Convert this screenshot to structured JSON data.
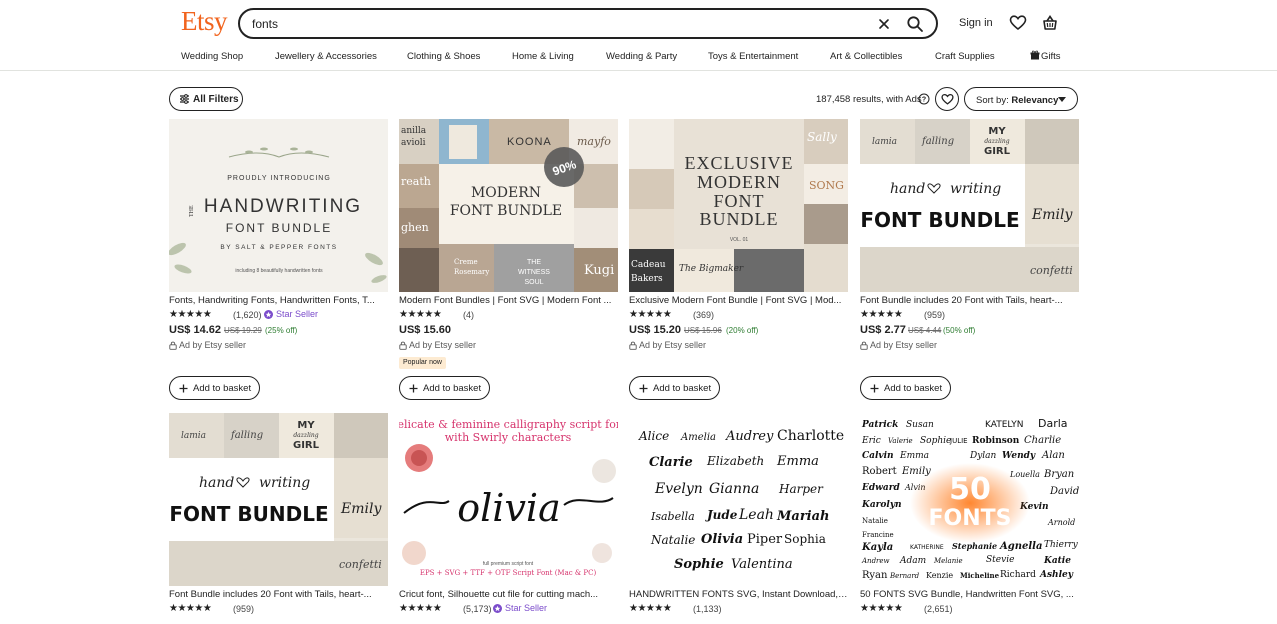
{
  "header": {
    "logo": "Etsy",
    "search_value": "fonts",
    "sign_in": "Sign in",
    "icons": [
      "close-icon",
      "search-icon",
      "heart-icon",
      "basket-icon"
    ]
  },
  "categories": [
    "Wedding Shop",
    "Jewellery & Accessories",
    "Clothing & Shoes",
    "Home & Living",
    "Wedding & Party",
    "Toys & Entertainment",
    "Art & Collectibles",
    "Craft Supplies",
    "Gifts"
  ],
  "toolbar": {
    "filters_label": "All Filters",
    "results_text": "187,458 results, with Ads",
    "sort_prefix": "Sort by: ",
    "sort_value": "Relevancy"
  },
  "colors": {
    "brand": "#f1641e",
    "discount": "#2f7d32",
    "star_seller": "#7b4ccb",
    "popular_bg": "#fdebd2"
  },
  "basket_label": "Add to basket",
  "listings": [
    {
      "title": "Fonts, Handwriting Fonts, Handwritten Fonts, T...",
      "stars": "★★★★★",
      "count": "(1,620)",
      "badge": "Star Seller",
      "price": "US$ 14.62",
      "original": "US$ 19.29",
      "discount": "(25% off)",
      "ad": "Ad by Etsy seller",
      "popular": "",
      "image_text": {
        "l1": "PROUDLY INTRODUCING",
        "l2": "THE",
        "l3": "HANDWRITING",
        "l4": "FONT BUNDLE",
        "l5": "BY SALT & PEPPER FONTS",
        "l6": "including 8 beautifully handwritten fonts"
      }
    },
    {
      "title": "Modern Font Bundles | Font SVG | Modern Font ...",
      "stars": "★★★★★",
      "count": "(4)",
      "badge": "",
      "price": "US$ 15.60",
      "original": "",
      "discount": "",
      "ad": "Ad by Etsy seller",
      "popular": "Popular now",
      "image_text": {
        "l1": "MODERN",
        "l2": "FONT BUNDLE",
        "l3": "90%",
        "t1": "anilla",
        "t2": "avioli",
        "t3": "KOONA",
        "t4": "mayfo",
        "t5": "reath",
        "t6": "ghen",
        "t7": "Creme",
        "t8": "Rosemary",
        "t9": "THE",
        "t10": "WITNESS",
        "t11": "SOUL",
        "t12": "Kugi"
      }
    },
    {
      "title": "Exclusive Modern Font Bundle | Font SVG | Mod...",
      "stars": "★★★★★",
      "count": "(369)",
      "badge": "",
      "price": "US$ 15.20",
      "original": "US$ 15.96",
      "discount": "(20% off)",
      "ad": "Ad by Etsy seller",
      "popular": "",
      "image_text": {
        "l1": "EXCLUSIVE",
        "l2": "MODERN",
        "l3": "FONT",
        "l4": "BUNDLE",
        "l5": "VOL. 01",
        "t1": "Sally",
        "t2": "SONG",
        "t3": "Cadeau",
        "t4": "Bakers",
        "t5": "The Bigmaker"
      }
    },
    {
      "title": "Font Bundle includes 20 Font with Tails, heart-...",
      "stars": "★★★★★",
      "count": "(959)",
      "badge": "",
      "price": "US$ 2.77",
      "original": "US$ 4.44",
      "discount": "(50% off)",
      "ad": "Ad by Etsy seller",
      "popular": "",
      "image_text": {
        "l1": "hand",
        "l2": "writing",
        "l3": "FONT BUNDLE",
        "l4": "MY",
        "l5": "dazzling",
        "l6": "GIRL",
        "l7": "Emily",
        "l8": "falling",
        "l9": "confetti",
        "l10": "lamia"
      }
    },
    {
      "title": "Font Bundle includes 20 Font with Tails, heart-...",
      "stars": "★★★★★",
      "count": "(959)",
      "badge": "",
      "price": "",
      "original": "",
      "discount": "",
      "ad": "",
      "popular": "",
      "image_text": {
        "l1": "hand",
        "l2": "writing",
        "l3": "FONT BUNDLE",
        "l4": "MY",
        "l5": "dazzling",
        "l6": "GIRL",
        "l7": "Emily",
        "l8": "falling",
        "l9": "confetti",
        "l10": "lamia"
      }
    },
    {
      "title": "Cricut font, Silhouette cut file for cutting mach...",
      "stars": "★★★★★",
      "count": "(5,173)",
      "badge": "Star Seller",
      "price": "",
      "original": "",
      "discount": "",
      "ad": "",
      "popular": "",
      "image_text": {
        "l1": "Delicate & feminine calligraphy script font",
        "l2": "with Swirly characters",
        "l3": "olivia",
        "l4": "full premium script font",
        "l5": "EPS + SVG + TTF + OTF Script Font (Mac & PC)"
      }
    },
    {
      "title": "HANDWRITTEN FONTS SVG, Instant Download, ...",
      "stars": "★★★★★",
      "count": "(1,133)",
      "badge": "",
      "price": "",
      "original": "",
      "discount": "",
      "ad": "",
      "popular": "",
      "image_text": {
        "names": [
          "Alice",
          "Amelia",
          "Audrey",
          "Charlotte",
          "Clarie",
          "Elizabeth",
          "Emma",
          "Evelyn",
          "Gianna",
          "Harper",
          "Isabella",
          "Jude",
          "Leah",
          "Mariah",
          "Natalie",
          "Olivia",
          "Piper",
          "Sophia",
          "Sophie",
          "Valentina"
        ]
      }
    },
    {
      "title": "50 FONTS SVG Bundle, Handwritten Font SVG, ...",
      "stars": "★★★★★",
      "count": "(2,651)",
      "badge": "",
      "price": "",
      "original": "",
      "discount": "",
      "ad": "",
      "popular": "",
      "image_text": {
        "l1": "50",
        "l2": "FONTS",
        "names": [
          "Patrick",
          "Susan",
          "KATELYN",
          "Darla",
          "Eric",
          "Valerie",
          "Sophie",
          "JULIE",
          "Robinson",
          "Charlie",
          "Calvin",
          "Emma",
          "Dylan",
          "Wendy",
          "Alan",
          "Robert",
          "Emily",
          "Louella",
          "Bryan",
          "Edward",
          "Alvin",
          "David",
          "Karolyn",
          "Kevin",
          "Natalie",
          "Arnold",
          "Francine",
          "Kayla",
          "KATHERINE",
          "Stephanie",
          "Agnella",
          "Thierry",
          "Andrew",
          "Adam",
          "Melanie",
          "Stevie",
          "Katie",
          "Ryan",
          "Bernard",
          "Kenzie",
          "Micheline",
          "Richard",
          "Ashley"
        ]
      }
    }
  ]
}
